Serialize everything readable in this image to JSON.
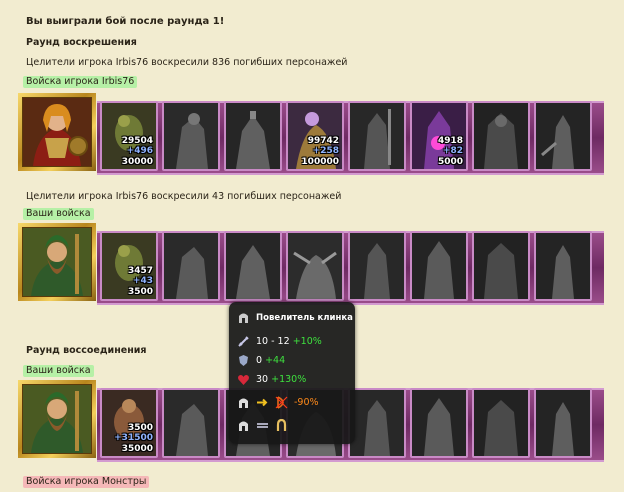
{
  "header": {
    "title": "Вы выиграли бой после раунда 1!",
    "round_resurrection": "Раунд воскрешения",
    "healers_line_1": "Целители игрока Irbis76 воскресили 836 погибших персонажей",
    "player_army_tag": "Войска игрока Irbis76",
    "healers_line_2": "Целители игрока Irbis76 воскресили 43 погибших персонажей",
    "your_army_tag": "Ваши войска",
    "round_reunion": "Раунд воссоединения",
    "your_army_tag_2": "Ваши войска",
    "monsters_tag": "Войска игрока Монстры"
  },
  "army1": {
    "units": [
      {
        "count": "29504",
        "bonus": "+496",
        "total": "30000"
      },
      {
        "count": "",
        "bonus": "",
        "total": ""
      },
      {
        "count": "",
        "bonus": "",
        "total": ""
      },
      {
        "count": "99742",
        "bonus": "+258",
        "total": "100000"
      },
      {
        "count": "",
        "bonus": "",
        "total": ""
      },
      {
        "count": "4918",
        "bonus": "+82",
        "total": "5000"
      },
      {
        "count": "",
        "bonus": "",
        "total": ""
      },
      {
        "count": "",
        "bonus": "",
        "total": ""
      }
    ]
  },
  "army2": {
    "units": [
      {
        "count": "3457",
        "bonus": "+43",
        "total": "3500"
      }
    ]
  },
  "army3": {
    "units": [
      {
        "count": "3500",
        "bonus": "+31500",
        "total": "35000"
      }
    ]
  },
  "tooltip": {
    "name": "Повелитель клинка",
    "attack": "10 - 12",
    "attack_bonus": "+10%",
    "defense": "0",
    "defense_bonus": "+44",
    "health": "30",
    "health_bonus": "+130%",
    "ranged_penalty": "-90%"
  },
  "colors": {
    "band": "#7c3570",
    "slot_border": "#c98ac6",
    "tag_green": "#b6f0a6",
    "tag_red": "#f5b8b8",
    "bonus_green": "#3ee03e",
    "penalty_orange": "#ff8a1a"
  }
}
